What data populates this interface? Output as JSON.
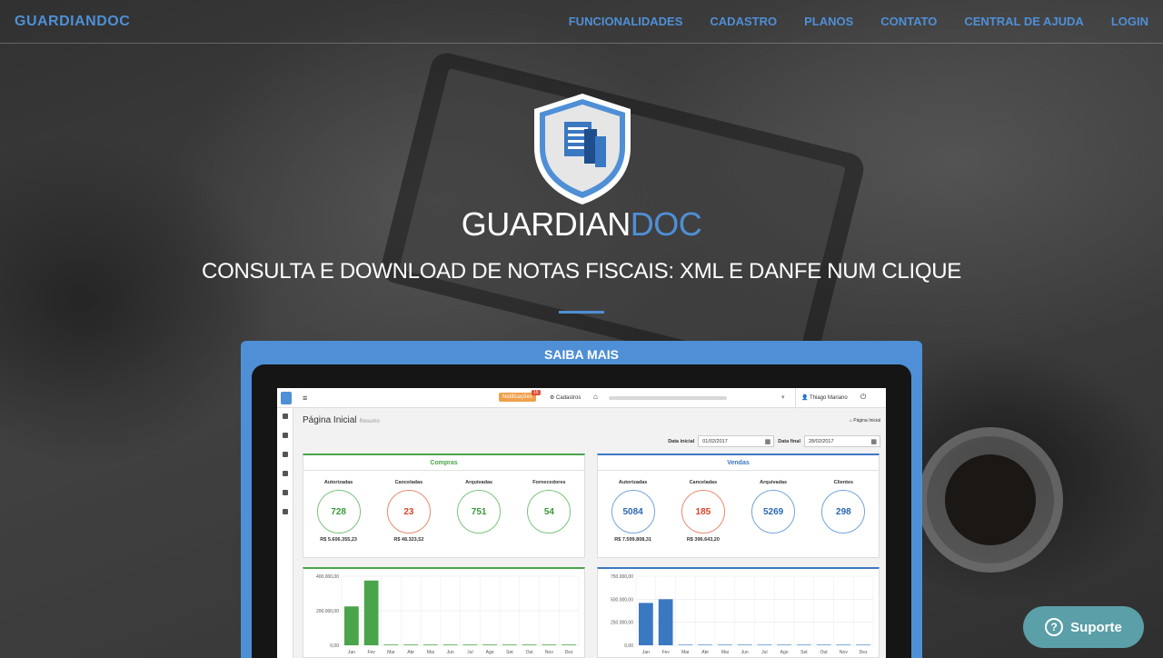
{
  "nav": {
    "brand": "GUARDIANDOC",
    "links": [
      "FUNCIONALIDADES",
      "CADASTRO",
      "PLANOS",
      "CONTATO",
      "CENTRAL DE AJUDA",
      "LOGIN"
    ]
  },
  "hero": {
    "logo_main": "GUARDIAN",
    "logo_accent": "DOC",
    "tagline": "CONSULTA E DOWNLOAD DE NOTAS FISCAIS: XML E DANFE NUM CLIQUE"
  },
  "panel": {
    "label": "SAIBA MAIS"
  },
  "app": {
    "topbar": {
      "notifications": "Notificações",
      "notif_count": "15",
      "cadastros": "Cadastros",
      "user": "Thiago Mariano"
    },
    "page_title": "Página Inicial",
    "page_subtitle": "Resumo",
    "breadcrumb": "Página Inicial",
    "date_start_label": "Data inicial",
    "date_start": "01/02/2017",
    "date_end_label": "Data final",
    "date_end": "28/02/2017",
    "compras": {
      "title": "Compras",
      "stats": [
        {
          "label": "Autorizadas",
          "value": "728",
          "amount": "R$ 5.606.355,23",
          "color": "g"
        },
        {
          "label": "Canceladas",
          "value": "23",
          "amount": "R$ 48.323,52",
          "color": "r"
        },
        {
          "label": "Arquivadas",
          "value": "751",
          "amount": "",
          "color": "g"
        },
        {
          "label": "Fornecedores",
          "value": "54",
          "amount": "",
          "color": "g"
        }
      ]
    },
    "vendas": {
      "title": "Vendas",
      "stats": [
        {
          "label": "Autorizadas",
          "value": "5084",
          "amount": "R$ 7.599.808,31",
          "color": "b"
        },
        {
          "label": "Canceladas",
          "value": "185",
          "amount": "R$ 396.643,20",
          "color": "r"
        },
        {
          "label": "Arquivadas",
          "value": "5269",
          "amount": "",
          "color": "b"
        },
        {
          "label": "Clientes",
          "value": "298",
          "amount": "",
          "color": "b"
        }
      ]
    }
  },
  "chart_data": [
    {
      "type": "bar",
      "categories": [
        "Jan",
        "Fev",
        "Mar",
        "Abr",
        "Mai",
        "Jun",
        "Jul",
        "Ago",
        "Set",
        "Out",
        "Nov",
        "Dez"
      ],
      "values": [
        225000,
        375000,
        4000,
        4000,
        4000,
        4000,
        4000,
        4000,
        4000,
        4000,
        4000,
        4000
      ],
      "ylim": [
        0,
        400000
      ],
      "yticks": [
        "400.000,00",
        "200.000,00",
        "0,00"
      ],
      "color": "#4aa44a"
    },
    {
      "type": "bar",
      "categories": [
        "Jan",
        "Fev",
        "Mar",
        "Abr",
        "Mai",
        "Jun",
        "Jul",
        "Ago",
        "Set",
        "Out",
        "Nov",
        "Dez"
      ],
      "values": [
        460000,
        500000,
        6000,
        6000,
        6000,
        6000,
        6000,
        6000,
        6000,
        6000,
        6000,
        6000
      ],
      "ylim": [
        0,
        750000
      ],
      "yticks": [
        "750.000,00",
        "500.000,00",
        "250.000,00",
        "0,00"
      ],
      "color": "#3a78c2"
    }
  ],
  "suporte": {
    "label": "Suporte"
  }
}
